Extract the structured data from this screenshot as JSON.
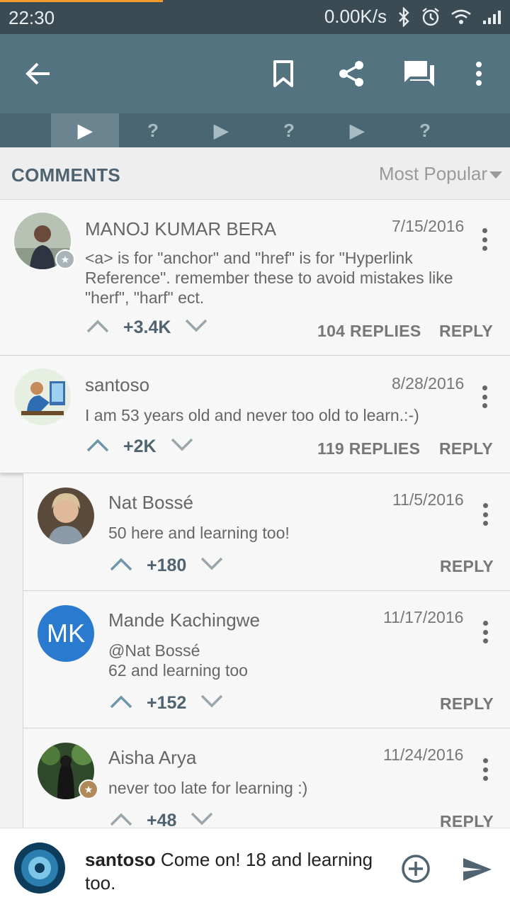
{
  "status_bar": {
    "time": "22:30",
    "network_speed": "0.00K/s"
  },
  "app_bar": {
    "icons": [
      "back-arrow-icon",
      "bookmark-icon",
      "share-icon",
      "comments-icon",
      "more-vert-icon"
    ]
  },
  "lesson_steps": [
    {
      "label": "▶",
      "active": true
    },
    {
      "label": "?",
      "active": false
    },
    {
      "label": "▶",
      "active": false
    },
    {
      "label": "?",
      "active": false
    },
    {
      "label": "▶",
      "active": false
    },
    {
      "label": "?",
      "active": false
    }
  ],
  "comments_header": {
    "title": "COMMENTS",
    "sort_label": "Most Popular"
  },
  "comments": [
    {
      "name": "MANOJ KUMAR BERA",
      "date": "7/15/2016",
      "text_lines": [
        "<a> is for \"anchor\" and \"href\" is for \"Hyperlink",
        "Reference\". remember these to avoid mistakes like",
        "\"herf\", \"harf\" ect."
      ],
      "votes": "+3.4K",
      "replies": "104 REPLIES",
      "reply_label": "REPLY"
    },
    {
      "name": "santoso",
      "date": "8/28/2016",
      "text_lines": [
        "I am 53 years old and never too old to learn.:-)"
      ],
      "votes": "+2K",
      "replies": "119 REPLIES",
      "reply_label": "REPLY"
    },
    {
      "name": "Nat Bossé",
      "date": "11/5/2016",
      "text_lines": [
        "50 here and learning too!"
      ],
      "votes": "+180",
      "reply_label": "REPLY"
    },
    {
      "name": "Mande Kachingwe",
      "initials": "MK",
      "date": "11/17/2016",
      "text_lines": [
        "@Nat Bossé",
        "62 and learning too"
      ],
      "votes": "+152",
      "reply_label": "REPLY"
    },
    {
      "name": "Aisha Arya",
      "date": "11/24/2016",
      "text_lines": [
        "never too late for learning  :)"
      ],
      "votes": "+48",
      "reply_label": "REPLY"
    }
  ],
  "input_bar": {
    "reply_to": "santoso",
    "message": "Come on! 18 and learning too."
  },
  "colors": {
    "status_bar": "#3a4b54",
    "app_bar": "#547380",
    "lesson_bar": "#4b6673",
    "accent_text": "#4f6470",
    "upvoted": "#6f95ab"
  }
}
